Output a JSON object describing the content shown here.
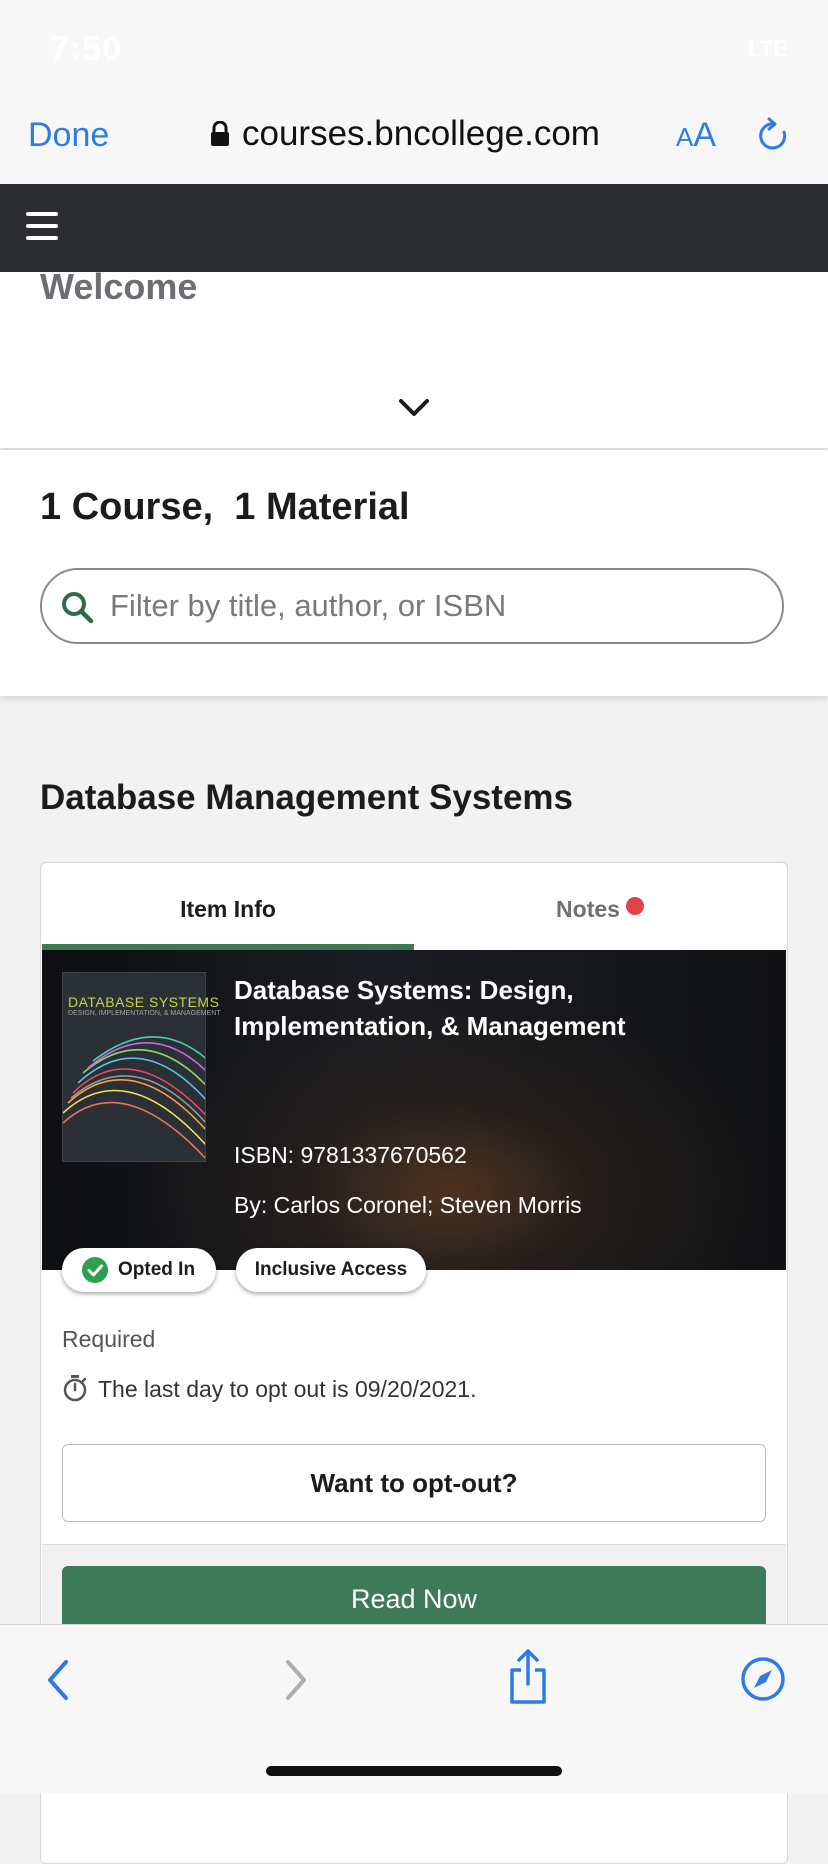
{
  "status_bar": {
    "time": "7:50",
    "network": "LTE"
  },
  "browser": {
    "done_label": "Done",
    "url": "courses.bncollege.com",
    "text_size_small": "A",
    "text_size_large": "A"
  },
  "welcome": {
    "title": "Welcome"
  },
  "summary": {
    "text": "1 Course,  1 Material",
    "search_placeholder": "Filter by title, author, or ISBN"
  },
  "course": {
    "title": "Database Management Systems"
  },
  "card": {
    "tabs": [
      {
        "label": "Item Info",
        "active": true
      },
      {
        "label": "Notes",
        "active": false,
        "has_notification": true
      }
    ],
    "book": {
      "cover_title": "DATABASE SYSTEMS",
      "cover_subtitle": "DESIGN, IMPLEMENTATION, & MANAGEMENT",
      "title": "Database Systems: Design, Implementation, & Management",
      "isbn": "ISBN: 9781337670562",
      "authors": "By: Carlos Coronel; Steven Morris"
    },
    "badges": {
      "opted_in": "Opted In",
      "inclusive": "Inclusive Access"
    },
    "required": "Required",
    "opt_out_deadline": "The last day to opt out is 09/20/2021.",
    "opt_out_button": "Want to opt-out?",
    "read_button": "Read Now"
  },
  "colors": {
    "accent_blue": "#2f7be6",
    "brand_green": "#3e7a58",
    "nav_dark": "#2c2d31",
    "notify_red": "#e0434b"
  }
}
